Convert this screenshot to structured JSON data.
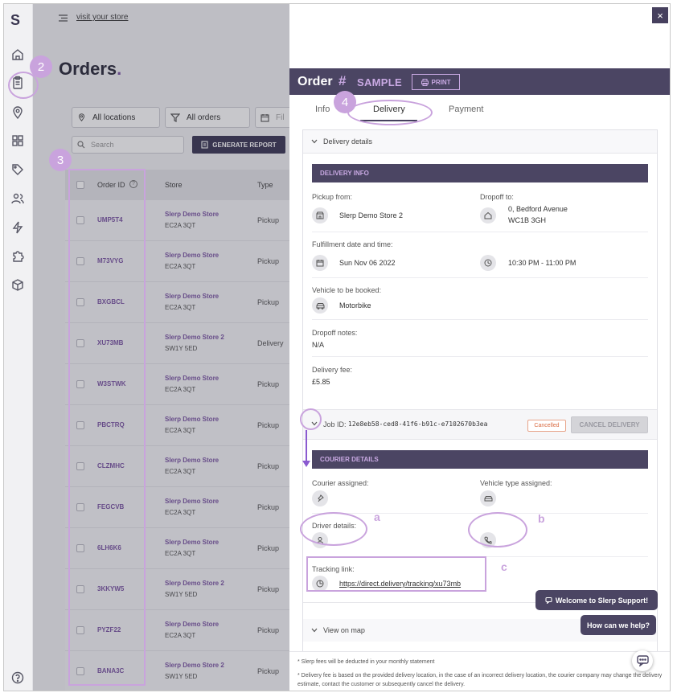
{
  "topbar": {
    "visit_store": "visit your store"
  },
  "orders_page": {
    "title": "Orders",
    "title_dot": ".",
    "filters": {
      "locations": "All locations",
      "orders": "All orders",
      "date_placeholder": "Fil"
    },
    "search_placeholder": "Search",
    "generate_report": "GENERATE REPORT",
    "table": {
      "columns": [
        "Order ID",
        "Store",
        "Type"
      ],
      "rows": [
        {
          "id": "UMP5T4",
          "store": "Slerp Demo Store",
          "postcode": "EC2A 3QT",
          "type": "Pickup"
        },
        {
          "id": "M73VYG",
          "store": "Slerp Demo Store",
          "postcode": "EC2A 3QT",
          "type": "Pickup"
        },
        {
          "id": "BXGBCL",
          "store": "Slerp Demo Store",
          "postcode": "EC2A 3QT",
          "type": "Pickup"
        },
        {
          "id": "XU73MB",
          "store": "Slerp Demo Store 2",
          "postcode": "SW1Y 5ED",
          "type": "Delivery"
        },
        {
          "id": "W3STWK",
          "store": "Slerp Demo Store",
          "postcode": "EC2A 3QT",
          "type": "Pickup"
        },
        {
          "id": "PBCTRQ",
          "store": "Slerp Demo Store",
          "postcode": "EC2A 3QT",
          "type": "Pickup"
        },
        {
          "id": "CLZMHC",
          "store": "Slerp Demo Store",
          "postcode": "EC2A 3QT",
          "type": "Pickup"
        },
        {
          "id": "FEGCVB",
          "store": "Slerp Demo Store",
          "postcode": "EC2A 3QT",
          "type": "Pickup"
        },
        {
          "id": "6LH6K6",
          "store": "Slerp Demo Store",
          "postcode": "EC2A 3QT",
          "type": "Pickup"
        },
        {
          "id": "3KKYW5",
          "store": "Slerp Demo Store 2",
          "postcode": "SW1Y 5ED",
          "type": "Pickup"
        },
        {
          "id": "PYZF22",
          "store": "Slerp Demo Store",
          "postcode": "EC2A 3QT",
          "type": "Pickup"
        },
        {
          "id": "BANA3C",
          "store": "Slerp Demo Store 2",
          "postcode": "SW1Y 5ED",
          "type": "Pickup"
        }
      ]
    }
  },
  "panel": {
    "close": "×",
    "order_label": "Order",
    "hash": "#",
    "order_number": "SAMPLE",
    "print": "PRINT",
    "tabs": [
      "Info",
      "Delivery",
      "Payment"
    ],
    "active_tab": "Delivery",
    "delivery_details_label": "Delivery details",
    "delivery_info": {
      "banner": "DELIVERY INFO",
      "pickup_label": "Pickup from:",
      "pickup_value": "Slerp Demo Store 2",
      "dropoff_label": "Dropoff to:",
      "dropoff_line1": "0, Bedford Avenue",
      "dropoff_line2": "WC1B 3GH",
      "fulfillment_label": "Fulfillment date and time:",
      "date_value": "Sun Nov 06 2022",
      "time_value": "10:30 PM - 11:00 PM",
      "vehicle_label": "Vehicle to be booked:",
      "vehicle_value": "Motorbike",
      "notes_label": "Dropoff notes:",
      "notes_value": "N/A",
      "fee_label": "Delivery fee:",
      "fee_value": "£5.85"
    },
    "job": {
      "label": "Job ID:",
      "id": "12e8eb58-ced8-41f6-b91c-e7102670b3ea",
      "status": "Cancelled",
      "cancel_button": "CANCEL DELIVERY"
    },
    "courier": {
      "banner": "COURIER DETAILS",
      "assigned_label": "Courier assigned:",
      "vehicle_type_label": "Vehicle type assigned:",
      "driver_label": "Driver details:",
      "tracking_label": "Tracking link:",
      "tracking_url": "https://direct.delivery/tracking/xu73mb"
    },
    "view_on_map": "View on map",
    "footnotes": [
      "* Slerp fees will be deducted in your monthly statement",
      "* Delivery fee is based on the provided delivery location, in the case of an incorrect delivery location, the courier company may change the delivery estimate, contact the customer or subsequently cancel the delivery."
    ]
  },
  "support": {
    "welcome": "Welcome to Slerp Support!",
    "help": "How can we help?"
  },
  "annotations": {
    "m2": "2",
    "m3": "3",
    "m4": "4",
    "a": "a",
    "b": "b",
    "c": "c",
    "color": "#c9a3dd"
  },
  "colors": {
    "brand_dark": "#4b4563",
    "brand_purple": "#7e5aa6",
    "accent_light": "#c9a9e3",
    "cancelled": "#d96b42"
  }
}
